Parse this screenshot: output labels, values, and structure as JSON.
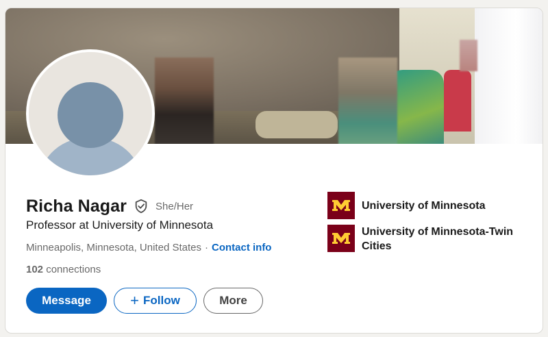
{
  "profile": {
    "name": "Richa Nagar",
    "pronouns": "She/Her",
    "headline": "Professor at University of Minnesota",
    "location": "Minneapolis, Minnesota, United States",
    "separator": "·",
    "contact_label": "Contact info",
    "connections_count": "102",
    "connections_label": "connections"
  },
  "actions": {
    "message_label": "Message",
    "follow_label": "Follow",
    "more_label": "More"
  },
  "organizations": [
    {
      "name": "University of Minnesota",
      "logo_icon": "umn-m-logo-icon"
    },
    {
      "name": "University of Minnesota-Twin Cities",
      "logo_icon": "umn-m-logo-icon"
    }
  ],
  "icons": {
    "verified": "shield-check-icon",
    "follow": "plus-icon",
    "avatar": "default-person-avatar-icon"
  },
  "colors": {
    "accent": "#0a66c2",
    "umn_maroon": "#7a0019",
    "umn_gold": "#ffcc33"
  }
}
